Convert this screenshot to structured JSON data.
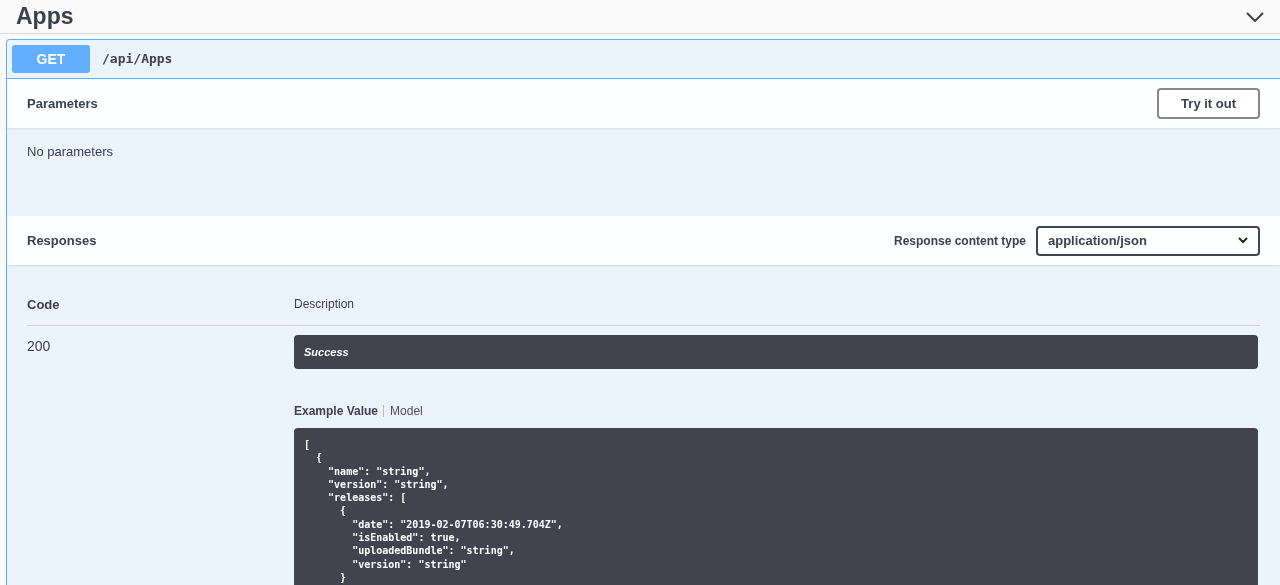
{
  "section": {
    "title": "Apps",
    "expanded": true
  },
  "operation": {
    "method": "GET",
    "path": "/api/Apps"
  },
  "parameters": {
    "title": "Parameters",
    "button": "Try it out",
    "empty_text": "No parameters"
  },
  "responses": {
    "title": "Responses",
    "content_type_label": "Response content type",
    "content_type": "application/json",
    "columns": [
      "Code",
      "Description"
    ],
    "rows": [
      {
        "code": "200",
        "description": "Success",
        "example_tabs": [
          {
            "label": "Example Value",
            "selected": true
          },
          {
            "label": "Model",
            "selected": false
          }
        ],
        "example_lines": [
          "[",
          "  {",
          "    \"name\": \"string\",",
          "    \"version\": \"string\",",
          "    \"releases\": [",
          "      {",
          "        \"date\": \"2019-02-07T06:30:49.704Z\",",
          "        \"isEnabled\": true,",
          "        \"uploadedBundle\": \"string\",",
          "        \"version\": \"string\"",
          "      }"
        ]
      }
    ]
  }
}
